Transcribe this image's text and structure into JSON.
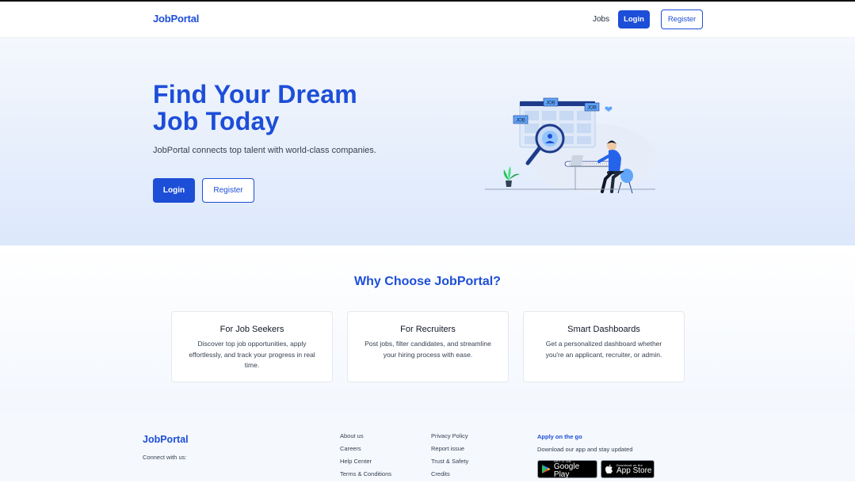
{
  "nav": {
    "brand": "JobPortal",
    "jobs": "Jobs",
    "login": "Login",
    "register": "Register"
  },
  "hero": {
    "title": "Find Your Dream Job Today",
    "subtitle": "JobPortal connects top talent with world-class companies.",
    "login": "Login",
    "register": "Register",
    "illustration": {
      "job_tags": [
        "JOB",
        "JOB",
        "JOB"
      ]
    }
  },
  "features": {
    "title": "Why Choose JobPortal?",
    "cards": [
      {
        "title": "For Job Seekers",
        "text": "Discover top job opportunities, apply effortlessly, and track your progress in real time."
      },
      {
        "title": "For Recruiters",
        "text": "Post jobs, filter candidates, and streamline your hiring process with ease."
      },
      {
        "title": "Smart Dashboards",
        "text": "Get a personalized dashboard whether you're an applicant, recruiter, or admin."
      }
    ]
  },
  "footer": {
    "brand": "JobPortal",
    "connect": "Connect with us:",
    "col1": [
      "About us",
      "Careers",
      "Help Center",
      "Terms & Conditions"
    ],
    "col2": [
      "Privacy Policy",
      "Report issue",
      "Trust & Safety",
      "Credits"
    ],
    "apply_title": "Apply on the go",
    "apply_sub": "Download our app and stay updated",
    "google_play": {
      "small": "GET IT ON",
      "big": "Google Play"
    },
    "app_store": {
      "small": "Download on the",
      "big": "App Store"
    }
  },
  "colors": {
    "accent": "#1d4ed8",
    "hero_bg_top": "#f4f7fd",
    "hero_bg_bottom": "#dce8fb"
  }
}
